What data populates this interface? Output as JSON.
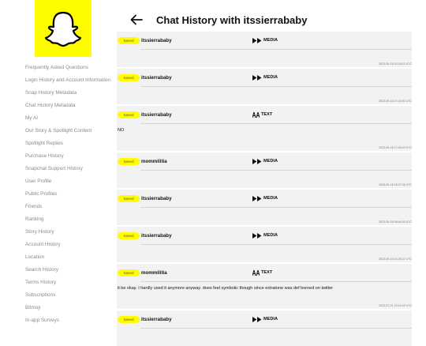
{
  "header": {
    "title": "Chat History with itssierrababy"
  },
  "icons": {
    "logo": "snapchat-ghost-icon",
    "back": "arrow-left-icon",
    "media": "play-media-icon",
    "text": "text-aa-icon"
  },
  "colors": {
    "brand_yellow": "#FFFC00",
    "card_bg": "#f2f2f2",
    "nav_text": "#8a8a8a"
  },
  "sidebar": {
    "items": [
      {
        "label": "Frequently Asked Questions"
      },
      {
        "label": "Login History and Account Information"
      },
      {
        "label": "Snap History Metadata"
      },
      {
        "label": "Chat History Metadata"
      },
      {
        "label": "My AI"
      },
      {
        "label": "Our Story & Spotlight Content"
      },
      {
        "label": "Spotlight Replies"
      },
      {
        "label": "Purchase History"
      },
      {
        "label": "Snapchat Support History"
      },
      {
        "label": "User Profile"
      },
      {
        "label": "Public Profiles"
      },
      {
        "label": "Friends"
      },
      {
        "label": "Ranking"
      },
      {
        "label": "Story History"
      },
      {
        "label": "Account History"
      },
      {
        "label": "Location"
      },
      {
        "label": "Search History"
      },
      {
        "label": "Terms History"
      },
      {
        "label": "Subscriptions"
      },
      {
        "label": "Bitmoji"
      },
      {
        "label": "In-app Surveys"
      }
    ]
  },
  "messages": [
    {
      "badge": "Saved",
      "sender": "itssierrababy",
      "type": "MEDIA",
      "content": "",
      "timestamp": "2023-09-18 20:18:21 UTC"
    },
    {
      "badge": "Saved",
      "sender": "itssierrababy",
      "type": "MEDIA",
      "content": "",
      "timestamp": "2023-09-18 17:15:30 UTC"
    },
    {
      "badge": "Saved",
      "sender": "itssierrababy",
      "type": "TEXT",
      "content": "NO",
      "timestamp": "2023-09-18 17:05:10 UTC"
    },
    {
      "badge": "Saved",
      "sender": "mommilitia",
      "type": "MEDIA",
      "content": "",
      "timestamp": "2023-09-18 15:07:44 UTC"
    },
    {
      "badge": "Saved",
      "sender": "itssierrababy",
      "type": "MEDIA",
      "content": "",
      "timestamp": "2023-09-18 09:44:20 UTC"
    },
    {
      "badge": "Saved",
      "sender": "itssierrababy",
      "type": "MEDIA",
      "content": "",
      "timestamp": "2023-09-16 16:28:27 UTC"
    },
    {
      "badge": "Saved",
      "sender": "mommilitia",
      "type": "TEXT",
      "content": "it be okay. I hardly used it anymore anyway. does feel symbolic though since extratone was def borned on twitter",
      "timestamp": "2023-07-21 22:19:42 UTC"
    },
    {
      "badge": "Saved",
      "sender": "itssierrababy",
      "type": "MEDIA",
      "content": "",
      "timestamp": ""
    }
  ]
}
